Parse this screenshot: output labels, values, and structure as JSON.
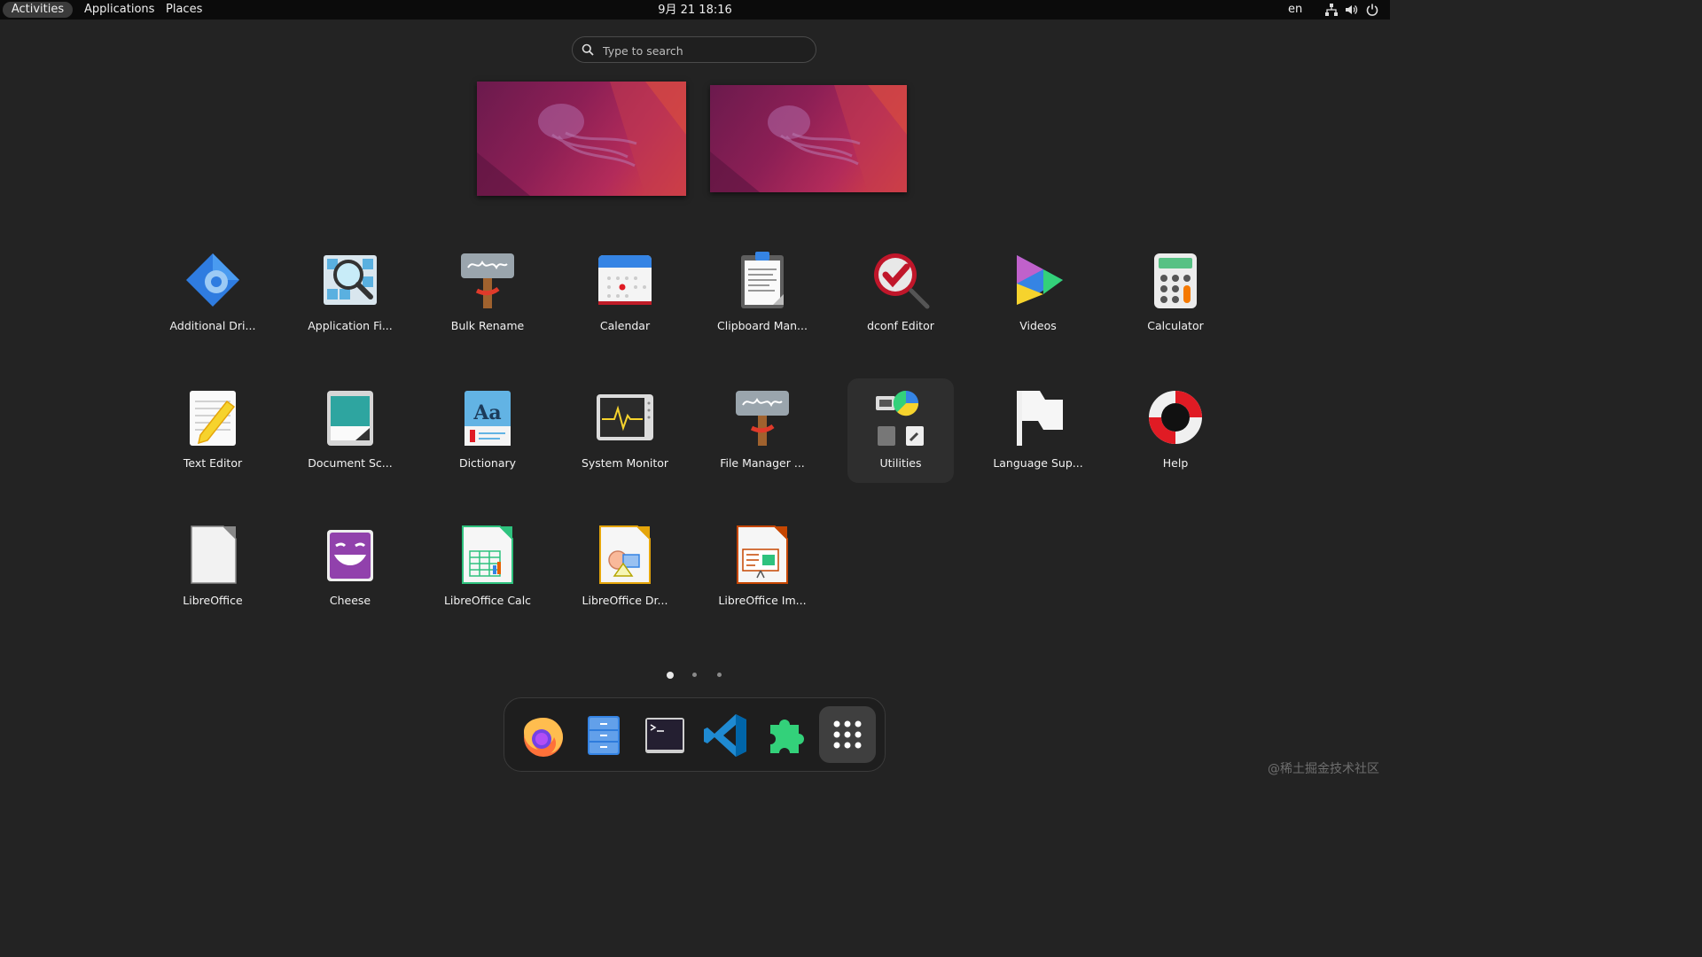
{
  "topbar": {
    "activities": "Activities",
    "applications": "Applications",
    "places": "Places",
    "clock": "9月 21  18:16",
    "lang": "en"
  },
  "search": {
    "placeholder": "Type to search"
  },
  "apps": [
    {
      "label": "Additional Dri...",
      "icon": "additional-drivers-icon"
    },
    {
      "label": "Application Fi...",
      "icon": "application-finder-icon"
    },
    {
      "label": "Bulk Rename",
      "icon": "bulk-rename-icon"
    },
    {
      "label": "Calendar",
      "icon": "calendar-icon"
    },
    {
      "label": "Clipboard Man...",
      "icon": "clipboard-manager-icon"
    },
    {
      "label": "dconf Editor",
      "icon": "dconf-editor-icon"
    },
    {
      "label": "Videos",
      "icon": "videos-icon"
    },
    {
      "label": "Calculator",
      "icon": "calculator-icon"
    },
    {
      "label": "Text Editor",
      "icon": "text-editor-icon"
    },
    {
      "label": "Document Sc...",
      "icon": "document-scanner-icon"
    },
    {
      "label": "Dictionary",
      "icon": "dictionary-icon"
    },
    {
      "label": "System Monitor",
      "icon": "system-monitor-icon"
    },
    {
      "label": "File Manager ...",
      "icon": "file-manager-settings-icon"
    },
    {
      "label": "Utilities",
      "icon": "utilities-folder-icon"
    },
    {
      "label": "Language Sup...",
      "icon": "language-support-icon"
    },
    {
      "label": "Help",
      "icon": "help-icon"
    },
    {
      "label": "LibreOffice",
      "icon": "libreoffice-icon"
    },
    {
      "label": "Cheese",
      "icon": "cheese-icon"
    },
    {
      "label": "LibreOffice Calc",
      "icon": "libreoffice-calc-icon"
    },
    {
      "label": "LibreOffice Dr...",
      "icon": "libreoffice-draw-icon"
    },
    {
      "label": "LibreOffice Im...",
      "icon": "libreoffice-impress-icon"
    }
  ],
  "dictionary_glyph": "Aa",
  "pages": {
    "count": 3,
    "current": 1
  },
  "dock": [
    "firefox-icon",
    "files-icon",
    "terminal-icon",
    "vscode-icon",
    "extensions-icon",
    "show-apps-icon"
  ],
  "watermark": "@稀土掘金技术社区"
}
